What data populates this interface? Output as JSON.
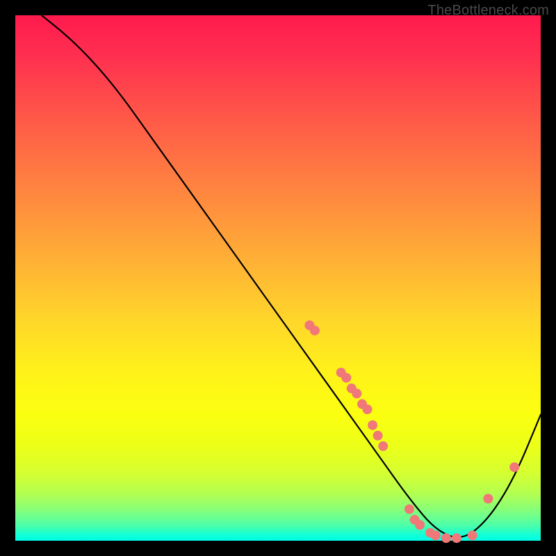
{
  "watermark": "TheBottleneck.com",
  "chart_data": {
    "type": "line",
    "title": "",
    "xlabel": "",
    "ylabel": "",
    "xlim": [
      0,
      100
    ],
    "ylim": [
      0,
      100
    ],
    "grid": false,
    "legend": false,
    "series": [
      {
        "name": "curve",
        "color": "#000000",
        "x": [
          5,
          10,
          15,
          20,
          25,
          30,
          35,
          40,
          45,
          50,
          55,
          60,
          65,
          70,
          75,
          80,
          85,
          90,
          95,
          100
        ],
        "values": [
          100,
          96,
          91,
          85,
          78,
          71,
          64,
          57,
          50,
          43,
          36,
          29,
          22,
          15,
          8,
          2,
          0,
          4,
          12,
          24
        ]
      }
    ],
    "markers": [
      {
        "x": 56,
        "y": 41
      },
      {
        "x": 57,
        "y": 40
      },
      {
        "x": 62,
        "y": 32
      },
      {
        "x": 63,
        "y": 31
      },
      {
        "x": 64,
        "y": 29
      },
      {
        "x": 65,
        "y": 28
      },
      {
        "x": 66,
        "y": 26
      },
      {
        "x": 67,
        "y": 25
      },
      {
        "x": 68,
        "y": 22
      },
      {
        "x": 69,
        "y": 20
      },
      {
        "x": 70,
        "y": 18
      },
      {
        "x": 75,
        "y": 6
      },
      {
        "x": 76,
        "y": 4
      },
      {
        "x": 77,
        "y": 3
      },
      {
        "x": 79,
        "y": 1.5
      },
      {
        "x": 80,
        "y": 1
      },
      {
        "x": 82,
        "y": 0.5
      },
      {
        "x": 84,
        "y": 0.5
      },
      {
        "x": 87,
        "y": 1
      },
      {
        "x": 90,
        "y": 8
      },
      {
        "x": 95,
        "y": 14
      }
    ],
    "marker_color": "#f07878"
  }
}
